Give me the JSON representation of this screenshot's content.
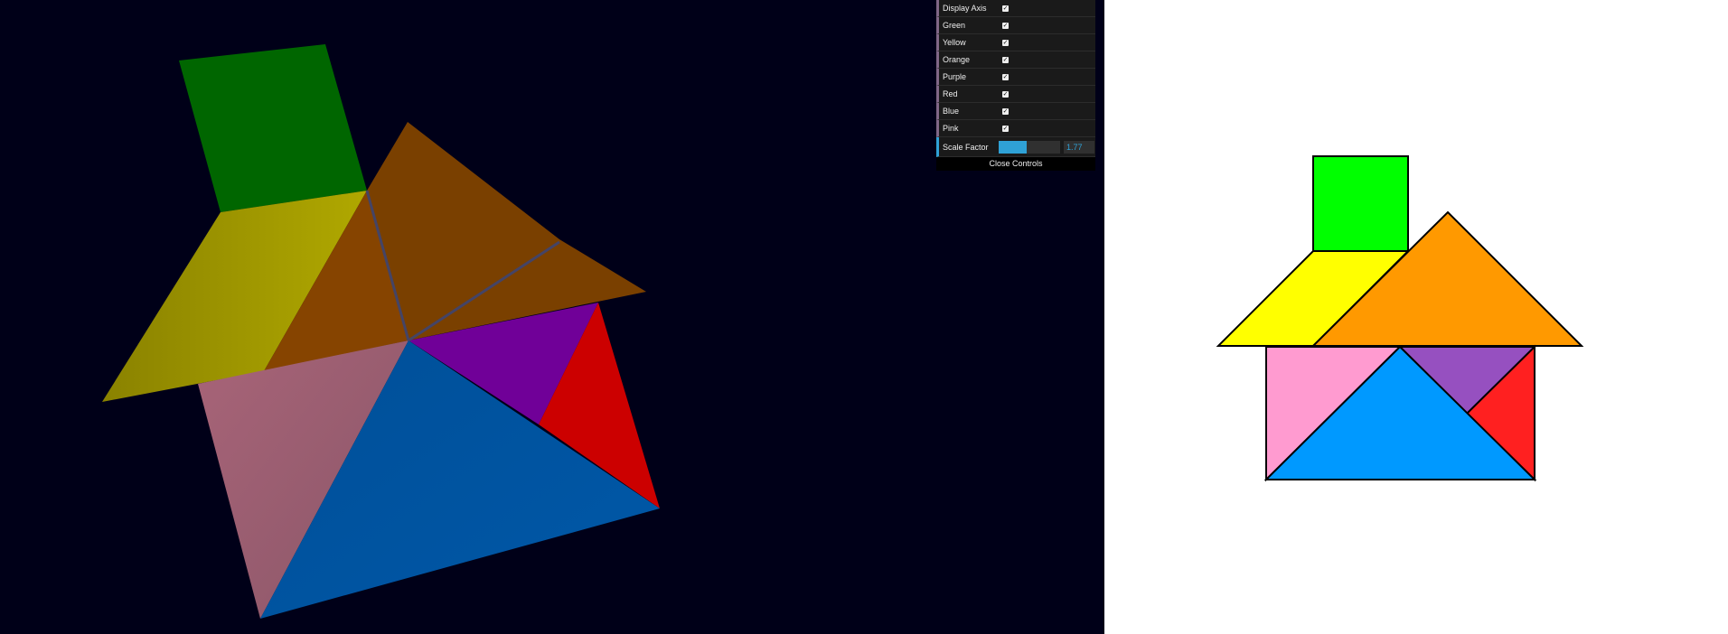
{
  "gui": {
    "items": [
      {
        "label": "Display Axis",
        "checked": true
      },
      {
        "label": "Green",
        "checked": true
      },
      {
        "label": "Yellow",
        "checked": true
      },
      {
        "label": "Orange",
        "checked": true
      },
      {
        "label": "Purple",
        "checked": true
      },
      {
        "label": "Red",
        "checked": true
      },
      {
        "label": "Blue",
        "checked": true
      },
      {
        "label": "Pink",
        "checked": true
      }
    ],
    "slider": {
      "label": "Scale Factor",
      "value": "1.77",
      "fill_fraction": 0.45
    },
    "close_label": "Close Controls"
  },
  "colors": {
    "scene_background": "#000018",
    "green_3d": "#006400",
    "yellow_3d": "#a8a000",
    "orange_3d": "#7a4000",
    "purple_3d": "#700098",
    "red_3d": "#cc0000",
    "blue_3d": "#00489a",
    "pink_3d": "#9e5f72",
    "green_2d": "#00ff00",
    "yellow_2d": "#ffff00",
    "orange_2d": "#ff9900",
    "purple_2d": "#9650c0",
    "red_2d": "#ff2020",
    "blue_2d": "#0099ff",
    "pink_2d": "#ff9bd0"
  }
}
